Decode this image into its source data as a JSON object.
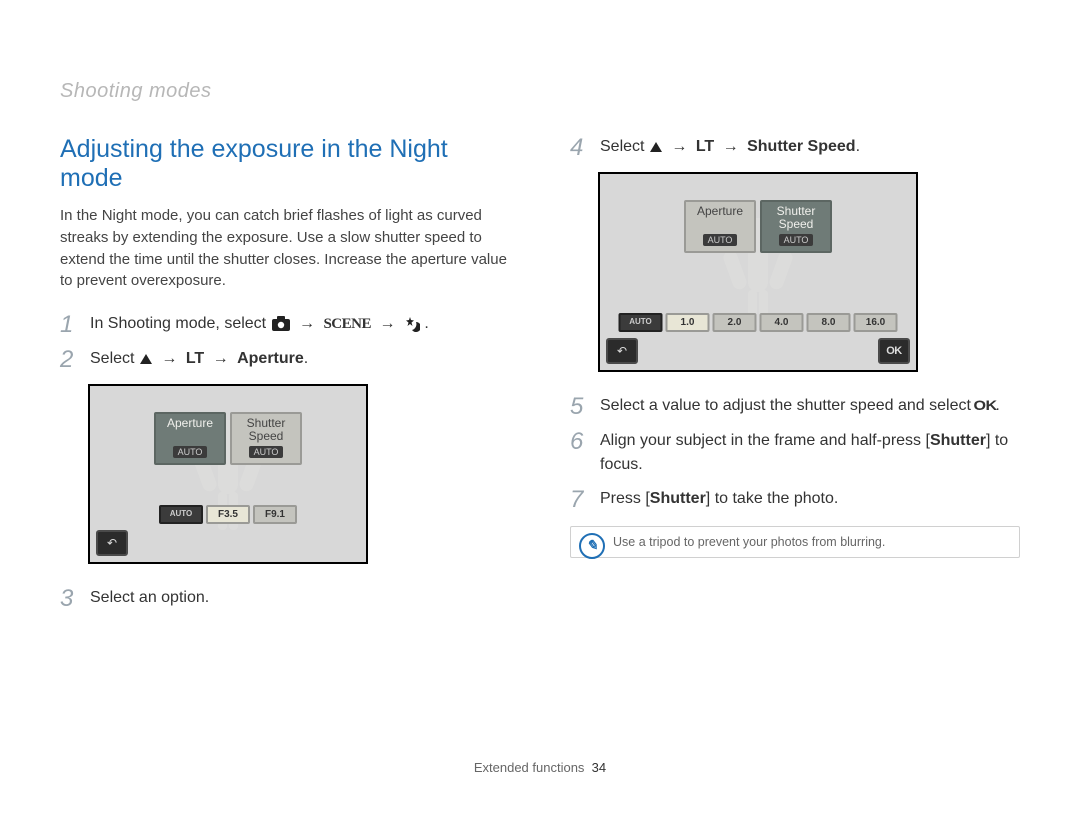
{
  "breadcrumb": "Shooting modes",
  "title": "Adjusting the exposure in the Night mode",
  "intro": "In the Night mode, you can catch brief flashes of light as curved streaks by extending the exposure. Use a slow shutter speed to extend the time until the shutter closes. Increase the aperture value to prevent overexposure.",
  "steps": {
    "1": {
      "num": "1",
      "pre": "In Shooting mode, select ",
      "seq_end": "."
    },
    "2": {
      "num": "2",
      "pre": "Select ",
      "target": "Aperture",
      "end": "."
    },
    "3": {
      "num": "3",
      "text": "Select an option."
    },
    "4": {
      "num": "4",
      "pre": "Select ",
      "target": "Shutter Speed",
      "end": "."
    },
    "5": {
      "num": "5",
      "text_pre": "Select a value to adjust the shutter speed and select ",
      "text_post": "."
    },
    "6": {
      "num": "6",
      "text_pre": "Align your subject in the frame and half-press [",
      "shutter": "Shutter",
      "text_post": "] to focus."
    },
    "7": {
      "num": "7",
      "text_pre": "Press [",
      "shutter": "Shutter",
      "text_post": "] to take the photo."
    }
  },
  "screenshot1": {
    "tabs": {
      "aperture": "Aperture",
      "shutter": "Shutter\nSpeed",
      "auto": "AUTO"
    },
    "values": {
      "auto": "AUTO",
      "v1": "F3.5",
      "v2": "F9.1"
    },
    "back": "↶"
  },
  "screenshot2": {
    "tabs": {
      "aperture": "Aperture",
      "shutter": "Shutter\nSpeed",
      "auto": "AUTO"
    },
    "values": {
      "auto": "AUTO",
      "v1": "1.0",
      "v2": "2.0",
      "v3": "4.0",
      "v4": "8.0",
      "v5": "16.0"
    },
    "back": "↶",
    "ok": "OK"
  },
  "tip": "Use a tripod to prevent your photos from blurring.",
  "icons": {
    "arrow": "→",
    "camera": "camera-icon",
    "scene": "SCENE",
    "night": "night-icon",
    "up": "up-icon",
    "lt": "LT",
    "ok": "OK"
  },
  "footer": {
    "section": "Extended functions",
    "page": "34"
  }
}
